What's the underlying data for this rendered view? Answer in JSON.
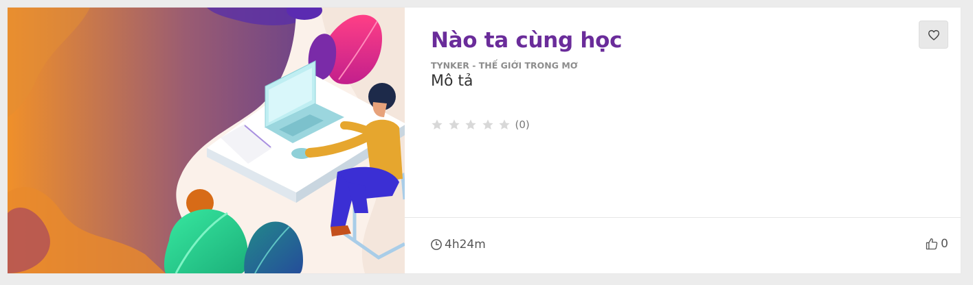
{
  "course": {
    "title": "Nào ta cùng học",
    "author": "TYNKER - THẾ GIỚI TRONG MƠ",
    "description": "Mô tả",
    "rating": {
      "stars": 5,
      "filled": 0,
      "count_label": "(0)",
      "star_color": "#d8d8d8"
    },
    "duration": "4h24m",
    "likes": "0"
  },
  "colors": {
    "title": "#6a2c9a",
    "author": "#8d8d8d",
    "wishlist_bg": "#e8e8e8"
  },
  "icons": {
    "wishlist": "heart-icon",
    "duration": "clock-icon",
    "likes": "thumbs-up-icon",
    "rating": "star-icon"
  }
}
